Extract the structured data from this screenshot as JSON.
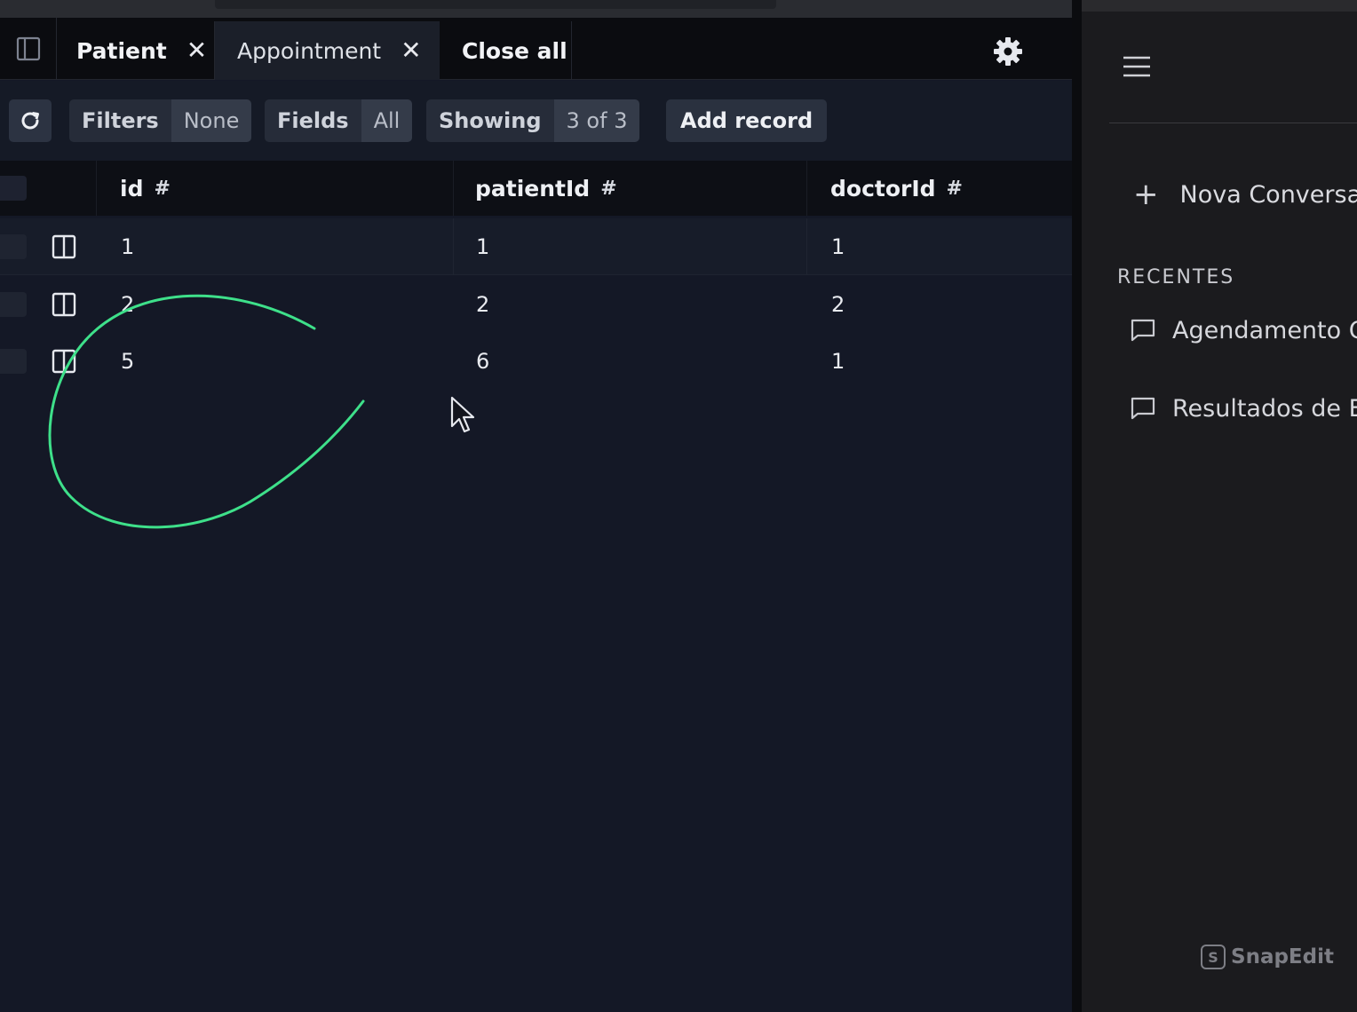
{
  "tabs": [
    {
      "label": "Patient",
      "close": "✕"
    },
    {
      "label": "Appointment",
      "close": "✕"
    },
    {
      "label": "Close all"
    }
  ],
  "toolbar": {
    "filters_label": "Filters",
    "filters_value": "None",
    "fields_label": "Fields",
    "fields_value": "All",
    "showing_label": "Showing",
    "showing_value": "3 of 3",
    "add_record_label": "Add record"
  },
  "table": {
    "columns": [
      {
        "label": "id",
        "type_icon": "#"
      },
      {
        "label": "patientId",
        "type_icon": "#"
      },
      {
        "label": "doctorId",
        "type_icon": "#"
      }
    ],
    "rows": [
      [
        "1",
        "1",
        "1"
      ],
      [
        "2",
        "2",
        "2"
      ],
      [
        "5",
        "6",
        "1"
      ]
    ]
  },
  "sidebar": {
    "new_chat_label": "Nova Conversa",
    "recent_heading": "RECENTES",
    "recent_items": [
      {
        "label": "Agendamento C"
      },
      {
        "label": "Resultados de E"
      }
    ]
  },
  "watermark": {
    "icon_glyph": "S",
    "label": "SnapEdit"
  },
  "colors": {
    "accent_annotation": "#3ee08a",
    "background": "#141826",
    "sidebar_background": "#1b1b1e"
  }
}
